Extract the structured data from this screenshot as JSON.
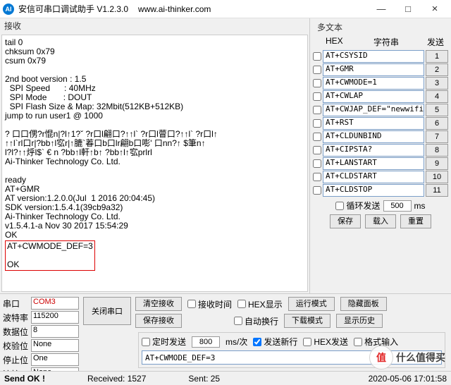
{
  "title": {
    "app": "安信可串口调试助手 V1.2.3.0",
    "url": "www.ai-thinker.com"
  },
  "win": {
    "min": "—",
    "max": "□",
    "close": "×"
  },
  "sections": {
    "recv": "接收",
    "multi": "多文本",
    "hex": "HEX",
    "str": "字符串",
    "send": "发送"
  },
  "recv_text": "tail 0\nchksum 0x79\ncsum 0x79\n\n2nd boot version : 1.5\n  SPI Speed      : 40MHz\n  SPI Mode       : DOUT\n  SPI Flash Size & Map: 32Mbit(512KB+512KB)\njump to run user1 @ 1000\n\n? 口口侽?r惃n|?l↑1?ˇ ?r口l翩口?↑↑l` ?r口l萺口?↑↑l` ?r口l↑\n↑↑l`rl口r|?bb↑l宖r|↑膔`萶口b口lr翩b口嘭' 口nn?↑ $筆n↑\nl?l?↑↑烀l$` € n ?bb↑l軒↑b↑ ?bb↑l↑宖prlrl\nAi-Thinker Technology Co. Ltd.\n\nready\nAT+GMR\nAT version:1.2.0.0(Jul  1 2016 20:04:45)\nSDK version:1.5.4.1(39cb9a32)\nAi-Thinker Technology Co. Ltd.\nv1.5.4.1-a Nov 30 2017 15:54:29\nOK",
  "redbox_text": "AT+CWMODE_DEF=3\n\nOK",
  "cmds": [
    {
      "txt": "AT+CSYSID",
      "n": "1"
    },
    {
      "txt": "AT+GMR",
      "n": "2"
    },
    {
      "txt": "AT+CWMODE=1",
      "n": "3"
    },
    {
      "txt": "AT+CWLAP",
      "n": "4"
    },
    {
      "txt": "AT+CWJAP_DEF=\"newwifi",
      "n": "5"
    },
    {
      "txt": "AT+RST",
      "n": "6"
    },
    {
      "txt": "AT+CLDUNBIND",
      "n": "7"
    },
    {
      "txt": "AT+CIPSTA?",
      "n": "8"
    },
    {
      "txt": "AT+LANSTART",
      "n": "9"
    },
    {
      "txt": "AT+CLDSTART",
      "n": "10"
    },
    {
      "txt": "AT+CLDSTOP",
      "n": "11"
    }
  ],
  "loop": {
    "label": "循环发送",
    "val": "500",
    "unit": "ms"
  },
  "btns": {
    "save": "保存",
    "load": "载入",
    "reset": "重置"
  },
  "port": {
    "labels": {
      "port": "串口",
      "baud": "波特率",
      "databits": "数据位",
      "parity": "校验位",
      "stopbits": "停止位",
      "flow": "流控"
    },
    "vals": {
      "port": "COM3",
      "baud": "115200",
      "databits": "8",
      "parity": "None",
      "stopbits": "One",
      "flow": "None"
    }
  },
  "mid": {
    "close_port": "关闭串口",
    "clear_recv": "清空接收",
    "save_recv": "保存接收",
    "recv_time": "接收时间",
    "hex_disp": "HEX显示",
    "auto_wrap": "自动换行",
    "run_mode": "运行模式",
    "dl_mode": "下载模式",
    "hide_panel": "隐藏面板",
    "show_hist": "显示历史"
  },
  "sendcfg": {
    "timed": "定时发送",
    "interval": "800",
    "unit": "ms/次",
    "newline": "发送新行",
    "hex_send": "HEX发送",
    "fmt_input": "格式输入",
    "value": "AT+CWMODE_DEF=3"
  },
  "status": {
    "ok": "Send OK !",
    "recv": "Received: 1527",
    "sent": "Sent: 25",
    "time": "2020-05-06 17:01:58"
  },
  "watermark": {
    "icon": "值",
    "text": "什么值得买"
  }
}
